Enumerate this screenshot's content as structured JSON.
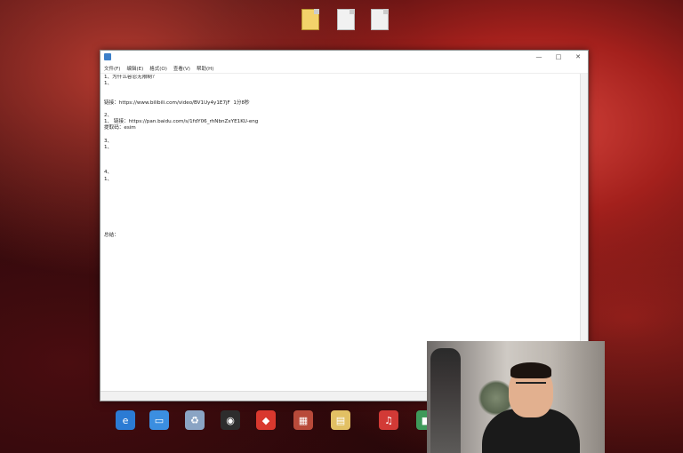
{
  "desktop_files": [
    {
      "label": "",
      "color": "yellow"
    },
    {
      "label": "",
      "color": "white"
    },
    {
      "label": "",
      "color": "white"
    }
  ],
  "window": {
    "title": "",
    "controls": [
      "—",
      "□",
      "✕"
    ],
    "menu": [
      "文件(F)",
      "编辑(E)",
      "格式(O)",
      "查看(V)",
      "帮助(H)"
    ],
    "lines": [
      "1、为什么容忍无限制？",
      "1、",
      "",
      "",
      "链接：https://www.bilibili.com/video/BV1Uy4y1E7jF  1分8秒",
      "",
      "2、",
      "1、 链接：https://pan.baidu.com/s/1fdY06_rhNbnZxYE1KU-eng",
      "提取码：esim",
      "",
      "3、",
      "1、",
      "",
      "",
      "",
      "4、",
      "1、",
      "",
      "",
      "",
      "",
      "",
      "",
      "",
      "",
      "总结：",
      "",
      ""
    ],
    "status": [
      "",
      "",
      ""
    ]
  },
  "taskbar": [
    {
      "label": "",
      "icon": "edge-icon",
      "color": "#2b7bd4",
      "glyph": "e"
    },
    {
      "label": "",
      "icon": "pc-icon",
      "color": "#3b8ee0",
      "glyph": "▭"
    },
    {
      "label": "",
      "icon": "recycle-bin-icon",
      "color": "#8aa4c4",
      "glyph": "♻"
    },
    {
      "label": "",
      "icon": "obs-icon",
      "color": "#2d2d2d",
      "glyph": "◉"
    },
    {
      "label": "",
      "icon": "qq-icon",
      "color": "#d9382e",
      "glyph": "◆"
    },
    {
      "label": "",
      "icon": "game-icon",
      "color": "#b84a3a",
      "glyph": "▦"
    },
    {
      "label": "",
      "icon": "document-icon",
      "color": "#e2c064",
      "glyph": "▤"
    },
    {
      "label": "",
      "icon": "netease-music-icon",
      "color": "#d23a36",
      "glyph": "♫"
    },
    {
      "label": "",
      "icon": "app-icon",
      "color": "#3e9a5a",
      "glyph": "■"
    }
  ],
  "watermark": {
    "line1": "",
    "line2": ""
  }
}
